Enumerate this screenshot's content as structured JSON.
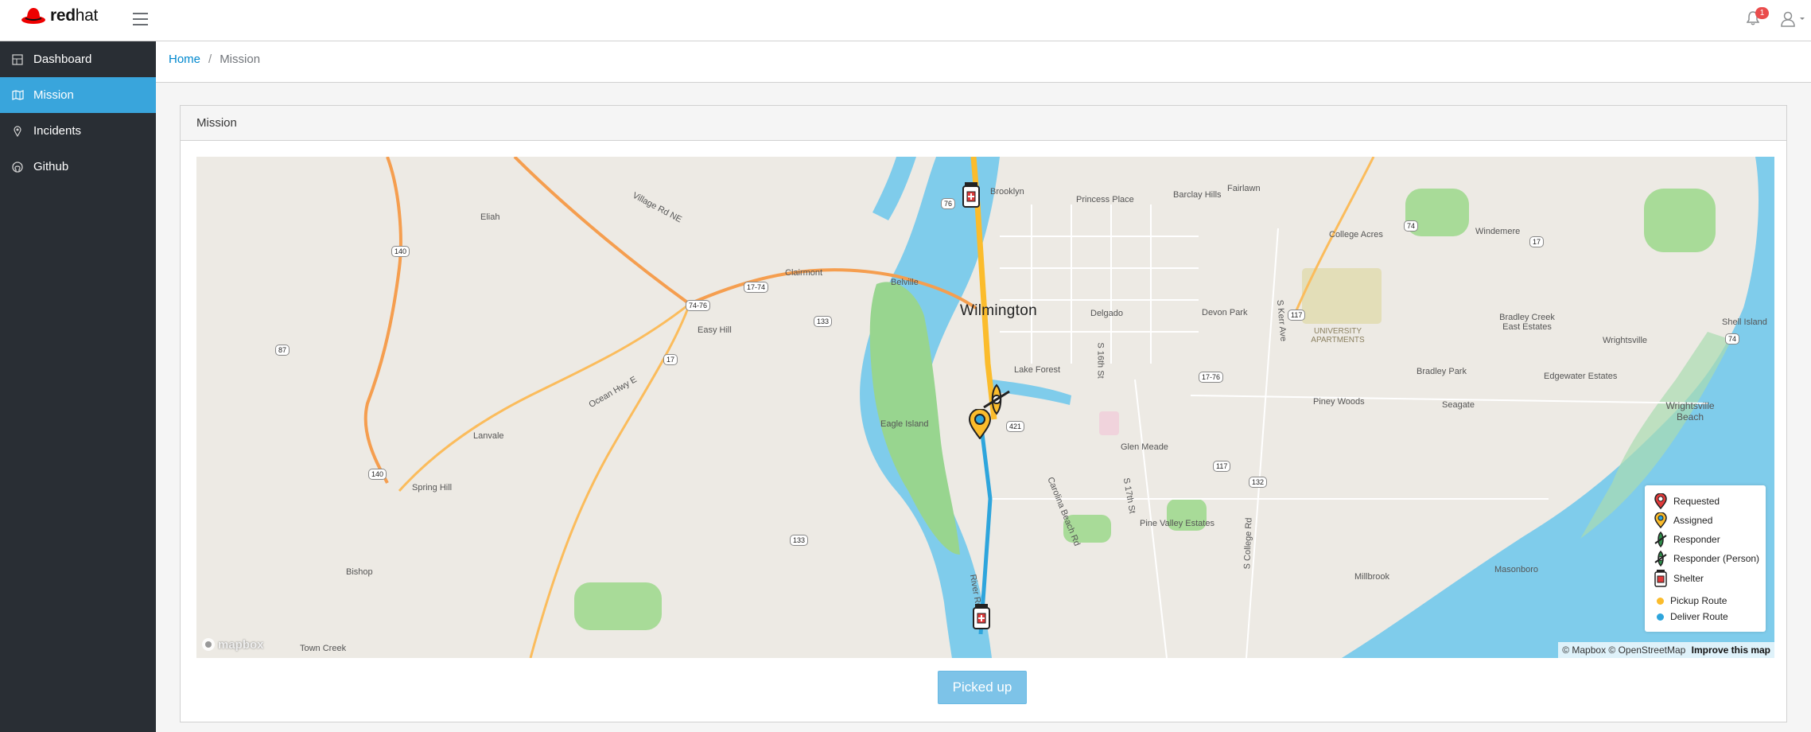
{
  "header": {
    "brand_bold": "red",
    "brand_light": "hat",
    "notification_count": "1"
  },
  "sidebar": {
    "items": [
      {
        "label": "Dashboard",
        "icon": "dashboard-icon",
        "active": false
      },
      {
        "label": "Mission",
        "icon": "map-icon",
        "active": true
      },
      {
        "label": "Incidents",
        "icon": "map-marker-icon",
        "active": false
      },
      {
        "label": "Github",
        "icon": "github-icon",
        "active": false
      }
    ]
  },
  "breadcrumb": {
    "home": "Home",
    "current": "Mission"
  },
  "card": {
    "title": "Mission"
  },
  "map": {
    "city_label": "Wilmington",
    "places": {
      "eliah": "Eliah",
      "village_rd": "Village Rd NE",
      "clairmont": "Clairmont",
      "belville": "Belville",
      "easy_hill": "Easy Hill",
      "ocean_hwy": "Ocean Hwy E",
      "lanvale": "Lanvale",
      "spring_hill": "Spring Hill",
      "bishop": "Bishop",
      "town_creek": "Town Creek",
      "eagle_island": "Eagle Island",
      "brooklyn": "Brooklyn",
      "princess_place": "Princess Place",
      "barclay_hills": "Barclay Hills",
      "fairlawn": "Fairlawn",
      "college_acres": "College Acres",
      "windemere": "Windemere",
      "delgado": "Delgado",
      "devon_park": "Devon Park",
      "s_kerr": "S Kerr Ave",
      "university_apts": "UNIVERSITY APARTMENTS",
      "bradley_creek": "Bradley Creek East Estates",
      "shell_island": "Shell Island",
      "wrightsville": "Wrightsville",
      "lake_forest": "Lake Forest",
      "s16": "S 16th St",
      "bradley_park": "Bradley Park",
      "edgewater": "Edgewater Estates",
      "wrightsville_beach": "Wrightsville Beach",
      "piney_woods": "Piney Woods",
      "seagate": "Seagate",
      "glen_meade": "Glen Meade",
      "s17": "S 17th St",
      "carolina_beach": "Carolina Beach Rd",
      "pine_valley": "Pine Valley Estates",
      "s_college": "S College Rd",
      "millbrook": "Millbrook",
      "masonboro": "Masonboro",
      "river_rd": "River Rd"
    },
    "shields": {
      "i140a": "140",
      "r87": "87",
      "r7476": "74-76",
      "r1774a": "17-74",
      "r133a": "133",
      "r17a": "17",
      "i140b": "140",
      "r133b": "133",
      "r76": "76",
      "r421": "421",
      "r117a": "117",
      "r74": "74",
      "r17b": "17",
      "r1776": "17-76",
      "r117b": "117",
      "r132": "132",
      "r74b": "74"
    },
    "legend": [
      {
        "label": "Requested",
        "icon": "requested-marker-icon"
      },
      {
        "label": "Assigned",
        "icon": "assigned-marker-icon"
      },
      {
        "label": "Responder",
        "icon": "responder-boat-icon"
      },
      {
        "label": "Responder (Person)",
        "icon": "responder-person-icon"
      },
      {
        "label": "Shelter",
        "icon": "shelter-icon"
      },
      {
        "label": "Pickup Route",
        "color": "#fbbc2c"
      },
      {
        "label": "Deliver Route",
        "color": "#2ea5dc"
      }
    ],
    "attribution_osm": "© Mapbox © OpenStreetMap",
    "improve_link": "Improve this map",
    "logo_text": "mapbox"
  },
  "actions": {
    "picked_up_label": "Picked up"
  }
}
